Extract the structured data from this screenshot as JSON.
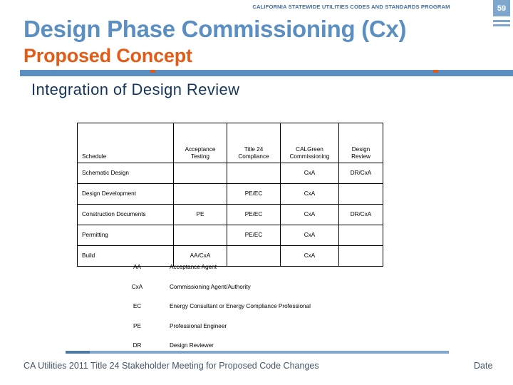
{
  "header": {
    "program": "CALIFORNIA STATEWIDE UTILITIES CODES AND STANDARDS PROGRAM",
    "page_number": "59"
  },
  "title": {
    "main": "Design Phase Commissioning (Cx)",
    "sub": "Proposed Concept",
    "main_color": "#5b8fc2",
    "sub_color": "#e05c17",
    "rule_color": "#5b8fc2"
  },
  "section": {
    "heading": "Integration of Design Review"
  },
  "table": {
    "columns": [
      "Schedule",
      "Acceptance Testing",
      "Title 24 Compliance",
      "CALGreen Commissioning",
      "Design Review"
    ],
    "rows": [
      {
        "schedule": "Schematic Design",
        "acceptance_testing": "",
        "title24": "",
        "calgreen": "CxA",
        "design_review": "DR/CxA"
      },
      {
        "schedule": "Design Development",
        "acceptance_testing": "",
        "title24": "PE/EC",
        "calgreen": "CxA",
        "design_review": ""
      },
      {
        "schedule": "Construction Documents",
        "acceptance_testing": "PE",
        "title24": "PE/EC",
        "calgreen": "CxA",
        "design_review": "DR/CxA"
      },
      {
        "schedule": "Permitting",
        "acceptance_testing": "",
        "title24": "PE/EC",
        "calgreen": "CxA",
        "design_review": ""
      },
      {
        "schedule": "Build",
        "acceptance_testing": "AA/CxA",
        "title24": "",
        "calgreen": "CxA",
        "design_review": ""
      }
    ]
  },
  "legend": [
    {
      "abbr": "AA",
      "definition": "Acceptance Agent"
    },
    {
      "abbr": "CxA",
      "definition": "Commissioning Agent/Authority"
    },
    {
      "abbr": "EC",
      "definition": "Energy Consultant or Energy Compliance Professional"
    },
    {
      "abbr": "PE",
      "definition": "Professional Engineer"
    },
    {
      "abbr": "DR",
      "definition": "Design Reviewer"
    }
  ],
  "footer": {
    "text": "CA Utilities 2011 Title 24 Stakeholder Meeting for Proposed Code Changes",
    "date": "Date"
  }
}
